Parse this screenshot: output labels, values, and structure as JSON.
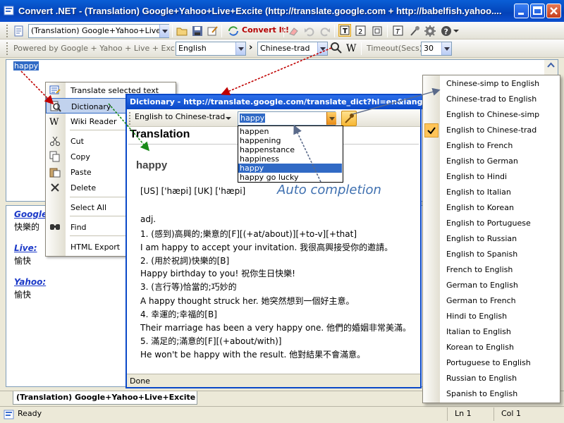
{
  "window": {
    "title": "Convert .NET - (Translation) Google+Yahoo+Live+Excite (http://translate.google.com + http://babelfish.yahoo...."
  },
  "toolbar": {
    "mode_combo": "(Translation) Google+Yahoo+Live+",
    "convert_label": "Convert It!"
  },
  "options_bar": {
    "powered_by": "Powered by Google + Yahoo + Live + Excite:",
    "source_lang": "English",
    "arrow": "›",
    "target_lang": "Chinese-trad",
    "timeout_label": "Timeout(Secs):",
    "timeout_value": "30"
  },
  "editor": {
    "selected_text": "happy"
  },
  "results": [
    {
      "engine": "Google:",
      "text": "快樂的"
    },
    {
      "engine": "Live:",
      "text": "愉快"
    },
    {
      "engine": "Yahoo:",
      "text": "愉快"
    }
  ],
  "context_menu": {
    "items": [
      {
        "label": "Translate selected text",
        "icon": "translate-icon"
      },
      {
        "label": "Dictionary",
        "icon": "dictionary-icon"
      },
      {
        "label": "Wiki Reader",
        "icon": "wiki-icon"
      },
      {
        "label": "Cut",
        "icon": "cut-icon"
      },
      {
        "label": "Copy",
        "icon": "copy-icon"
      },
      {
        "label": "Paste",
        "icon": "paste-icon"
      },
      {
        "label": "Delete",
        "icon": "delete-icon"
      },
      {
        "label": "Select All",
        "icon": ""
      },
      {
        "label": "Find",
        "icon": "find-icon"
      },
      {
        "label": "HTML Export",
        "icon": ""
      }
    ]
  },
  "dictionary": {
    "title": "Dictionary - http://translate.google.com/translate_dict?hl=en&langpair=",
    "direction": "English to Chinese-trad",
    "input_value": "happy",
    "header": "Translation",
    "word": "happy",
    "status": "Done",
    "lines": [
      "[US] ['hæpi]  [UK] ['hæpi]",
      "adj.",
      "1. (感到)高興的;樂意的[F][(+at/about)][+to-v][+that]",
      "I am happy to accept your invitation. 我很高興接受你的邀請。",
      "2. (用於祝詞)快樂的[B]",
      "Happy birthday to you! 祝你生日快樂!",
      "3. (言行等)恰當的;巧妙的",
      "A happy thought struck her. 她突然想到一個好主意。",
      "4. 幸運的;幸福的[B]",
      "Their marriage has been a very happy one. 他們的婚姻非常美滿。",
      "5. 滿足的;滿意的[F][(+about/with)]",
      "He won't be happy with the result. 他對結果不會滿意。"
    ]
  },
  "autocomplete": {
    "items": [
      "happen",
      "happening",
      "happenstance",
      "happiness",
      "happy",
      "happy go lucky"
    ],
    "selected": "happy",
    "annotation": "Auto completion"
  },
  "language_menu": {
    "items": [
      "Chinese-simp to English",
      "Chinese-trad to English",
      "English to Chinese-simp",
      "English to Chinese-trad",
      "English to French",
      "English to German",
      "English to Hindi",
      "English to Italian",
      "English to Korean",
      "English to Portuguese",
      "English to Russian",
      "English to Spanish",
      "French to English",
      "German to English",
      "German to French",
      "Hindi to English",
      "Italian to English",
      "Korean to English",
      "Portuguese to English",
      "Russian to English",
      "Spanish to English"
    ],
    "checked": "English to Chinese-trad"
  },
  "bottom_tab": {
    "label": "(Translation) Google+Yahoo+Live+Excite"
  },
  "status": {
    "text": "Ready",
    "line": "Ln 1",
    "col": "Col 1"
  },
  "colors": {
    "accent": "#0a48c8",
    "selection": "#316ac5",
    "highlight": "#c1d2ee",
    "link": "#1b39c8",
    "arrow_red": "#c00000",
    "arrow_green": "#1a8a1a",
    "arrow_blue": "#5a6a8a"
  }
}
